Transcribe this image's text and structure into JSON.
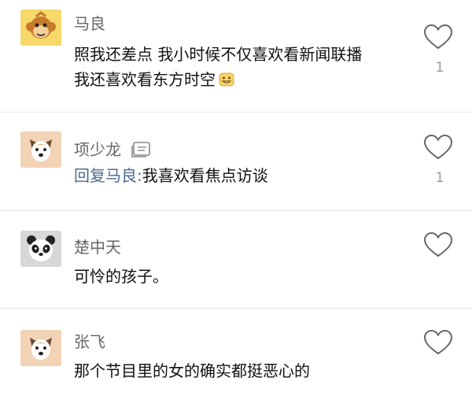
{
  "comments": [
    {
      "username": "马良",
      "avatar_icon": "monkey-avatar-icon",
      "content_lines": [
        "照我还差点  我小时候不仅喜欢看新闻联播",
        "我还喜欢看东方时空"
      ],
      "content_emoji": "grin-emoji-icon",
      "like_count": "1"
    },
    {
      "username": "项少龙",
      "avatar_icon": "dog-avatar-icon",
      "badge_icon": "news-ugc-icon",
      "reply_prefix": "回复马良:",
      "content_lines": [
        "我喜欢看焦点访谈"
      ],
      "like_count": "1"
    },
    {
      "username": "楚中天",
      "avatar_icon": "panda-avatar-icon",
      "content_lines": [
        "可怜的孩子。"
      ]
    },
    {
      "username": "张飞",
      "avatar_icon": "dog-avatar-icon",
      "content_lines": [
        "那个节目里的女的确实都挺恶心的"
      ]
    }
  ],
  "colors": {
    "monkey_bg": "#f7d86a",
    "dog_bg": "#f2d3b6",
    "panda_bg": "#d8d8d8",
    "username": "#666666",
    "reply_link": "#4c6a8f",
    "divider": "#e6e6e6"
  }
}
